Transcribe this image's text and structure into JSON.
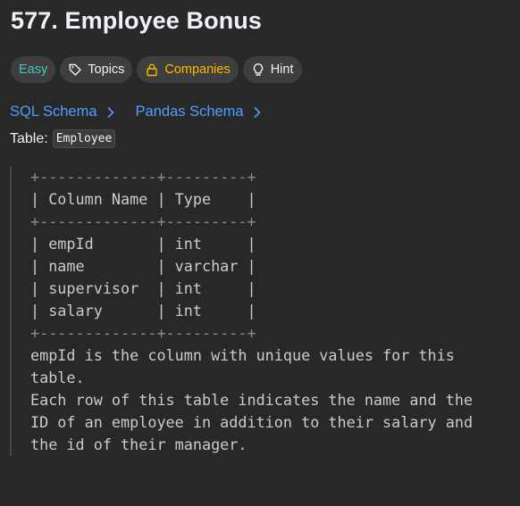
{
  "problem": {
    "title": "577. Employee Bonus"
  },
  "tags": [
    {
      "label": "Easy",
      "icon": ""
    },
    {
      "label": "Topics",
      "icon": "tag-icon"
    },
    {
      "label": "Companies",
      "icon": "lock-icon"
    },
    {
      "label": "Hint",
      "icon": "lightbulb-icon"
    }
  ],
  "links": {
    "sql_schema": "SQL Schema",
    "pandas_schema": "Pandas Schema"
  },
  "table_line": {
    "prefix": "Table:",
    "name": "Employee"
  },
  "schema": {
    "lines": [
      "+-------------+---------+",
      "| Column Name | Type    |",
      "+-------------+---------+",
      "| empId       | int     |",
      "| name        | varchar |",
      "| supervisor  | int     |",
      "| salary      | int     |",
      "+-------------+---------+",
      "empId is the column with unique values for this",
      "table.",
      "Each row of this table indicates the name and the",
      "ID of an employee in addition to their salary and",
      "the id of their manager."
    ]
  },
  "colors": {
    "background": "#282828",
    "easy": "#46c6c2",
    "companies": "#ffb800",
    "link": "#4f9fff"
  }
}
